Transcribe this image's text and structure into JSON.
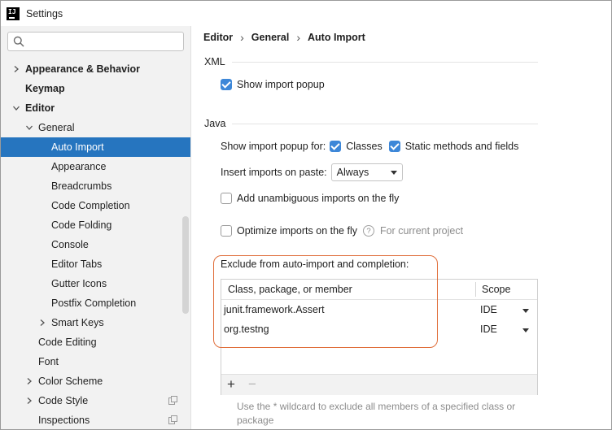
{
  "window": {
    "title": "Settings",
    "logo_text": "IJ"
  },
  "search": {
    "placeholder": "",
    "value": ""
  },
  "sidebar": {
    "items": [
      {
        "label": "Appearance & Behavior",
        "bold": true
      },
      {
        "label": "Keymap",
        "bold": true
      },
      {
        "label": "Editor",
        "bold": true
      },
      {
        "label": "General"
      },
      {
        "label": "Auto Import",
        "selected": true
      },
      {
        "label": "Appearance"
      },
      {
        "label": "Breadcrumbs"
      },
      {
        "label": "Code Completion"
      },
      {
        "label": "Code Folding"
      },
      {
        "label": "Console"
      },
      {
        "label": "Editor Tabs"
      },
      {
        "label": "Gutter Icons"
      },
      {
        "label": "Postfix Completion"
      },
      {
        "label": "Smart Keys"
      },
      {
        "label": "Code Editing"
      },
      {
        "label": "Font"
      },
      {
        "label": "Color Scheme"
      },
      {
        "label": "Code Style"
      },
      {
        "label": "Inspections"
      }
    ]
  },
  "breadcrumb": {
    "items": [
      "Editor",
      "General",
      "Auto Import"
    ],
    "separator": "›"
  },
  "xml": {
    "header": "XML",
    "show_import_popup": {
      "label": "Show import popup",
      "checked": true
    }
  },
  "java": {
    "header": "Java",
    "show_popup_for_label": "Show import popup for:",
    "classes": {
      "label": "Classes",
      "checked": true
    },
    "static": {
      "label": "Static methods and fields",
      "checked": true
    },
    "insert_on_paste_label": "Insert imports on paste:",
    "insert_on_paste_value": "Always",
    "add_unambiguous": {
      "label": "Add unambiguous imports on the fly",
      "checked": false
    },
    "optimize": {
      "label": "Optimize imports on the fly",
      "checked": false
    },
    "help_glyph": "?",
    "for_current_project": "For current project",
    "exclude_label": "Exclude from auto-import and completion:",
    "table": {
      "headers": [
        "Class, package, or member",
        "Scope"
      ],
      "rows": [
        {
          "name": "junit.framework.Assert",
          "scope": "IDE"
        },
        {
          "name": "org.testng",
          "scope": "IDE"
        }
      ],
      "add_glyph": "+",
      "remove_glyph": "−"
    },
    "hint": "Use the * wildcard to exclude all members of a specified class or package"
  },
  "colors": {
    "accent": "#2675bf",
    "checkbox": "#3d87d8",
    "highlight_annotation": "#e06e3a"
  }
}
